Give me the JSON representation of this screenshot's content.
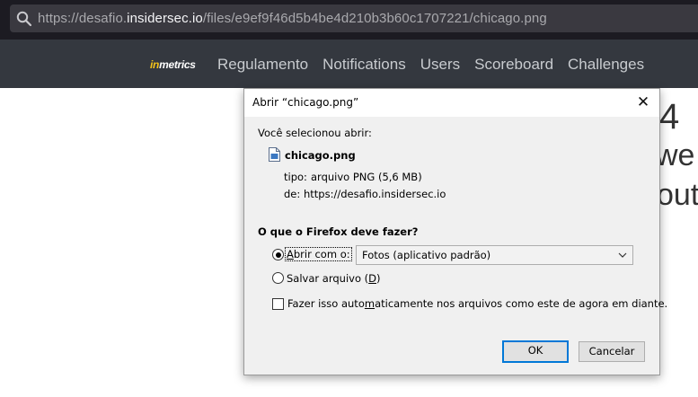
{
  "browser": {
    "url_prefix": "https://desafio.",
    "url_host": "insidersec.io",
    "url_path": "/files/e9ef9f46d5b4be4d210b3b60c1707221/chicago.png"
  },
  "navbar": {
    "logo_in": "in",
    "logo_rest": "metrics",
    "items": [
      {
        "label": "Regulamento"
      },
      {
        "label": "Notifications"
      },
      {
        "label": "Users"
      },
      {
        "label": "Scoreboard"
      },
      {
        "label": "Challenges"
      }
    ]
  },
  "background": {
    "line1": "4",
    "line2": "we",
    "line3": "out"
  },
  "dialog": {
    "title": "Abrir “chicago.png”",
    "selected_label": "Você selecionou abrir:",
    "file_name": "chicago.png",
    "tipo_label": "tipo:",
    "tipo_value": "arquivo PNG (5,6 MB)",
    "de_label": "de:",
    "de_value": "https://desafio.insidersec.io",
    "question": "O que o Firefox deve fazer?",
    "open_with": {
      "label_pre": "",
      "label_underlined": "A",
      "label_post": "brir com o:",
      "checked": true
    },
    "app_select_value": "Fotos (aplicativo padrão)",
    "save_file": {
      "label_pre": "Salvar arquivo (",
      "label_underlined": "D",
      "label_post": ")",
      "checked": false
    },
    "auto": {
      "label_pre": "Fazer isso auto",
      "label_underlined": "m",
      "label_post": "aticamente nos arquivos como este de agora em diante.",
      "checked": false
    },
    "ok_label": "OK",
    "cancel_label": "Cancelar"
  }
}
